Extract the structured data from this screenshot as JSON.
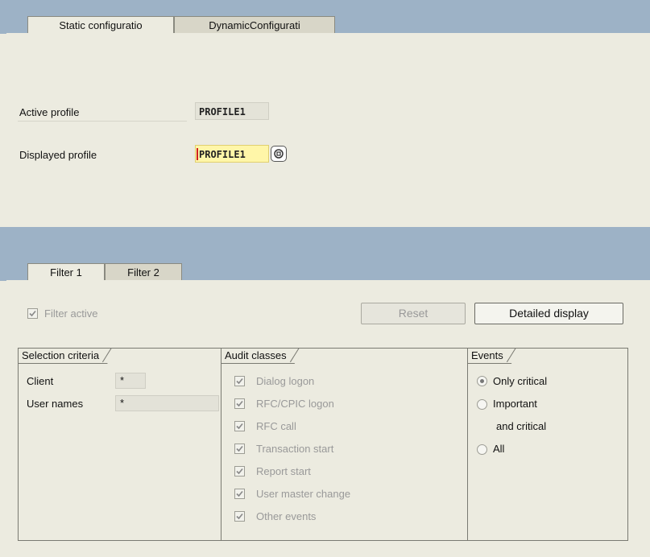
{
  "top_tabs": [
    "Static configuratio",
    "DynamicConfigurati"
  ],
  "profile": {
    "active_label": "Active profile",
    "active_value": "PROFILE1",
    "displayed_label": "Displayed profile",
    "displayed_value": "PROFILE1"
  },
  "filter_tabs": [
    "Filter 1",
    "Filter 2"
  ],
  "filter_active_label": "Filter active",
  "buttons": {
    "reset": "Reset",
    "detailed": "Detailed display"
  },
  "selection": {
    "title": "Selection criteria",
    "client_label": "Client",
    "client_value": "*",
    "users_label": "User names",
    "users_value": "*"
  },
  "audit": {
    "title": "Audit classes",
    "items": [
      "Dialog logon",
      "RFC/CPIC logon",
      "RFC call",
      "Transaction start",
      "Report start",
      "User master change",
      "Other events"
    ]
  },
  "events": {
    "title": "Events",
    "options": [
      "Only critical",
      "Important",
      "and critical",
      "All"
    ],
    "selected": "Only critical"
  }
}
